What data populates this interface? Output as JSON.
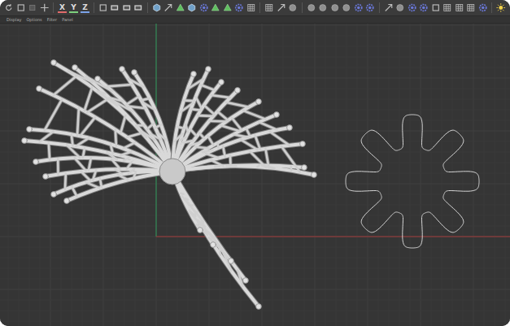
{
  "toolbar": {
    "axis_buttons": [
      {
        "label": "X",
        "color": "#e06a6a"
      },
      {
        "label": "Y",
        "color": "#7ccf7c"
      },
      {
        "label": "Z",
        "color": "#7aa2e8"
      }
    ]
  },
  "menu": [
    "Display",
    "Options",
    "Filter",
    "Panel"
  ]
}
